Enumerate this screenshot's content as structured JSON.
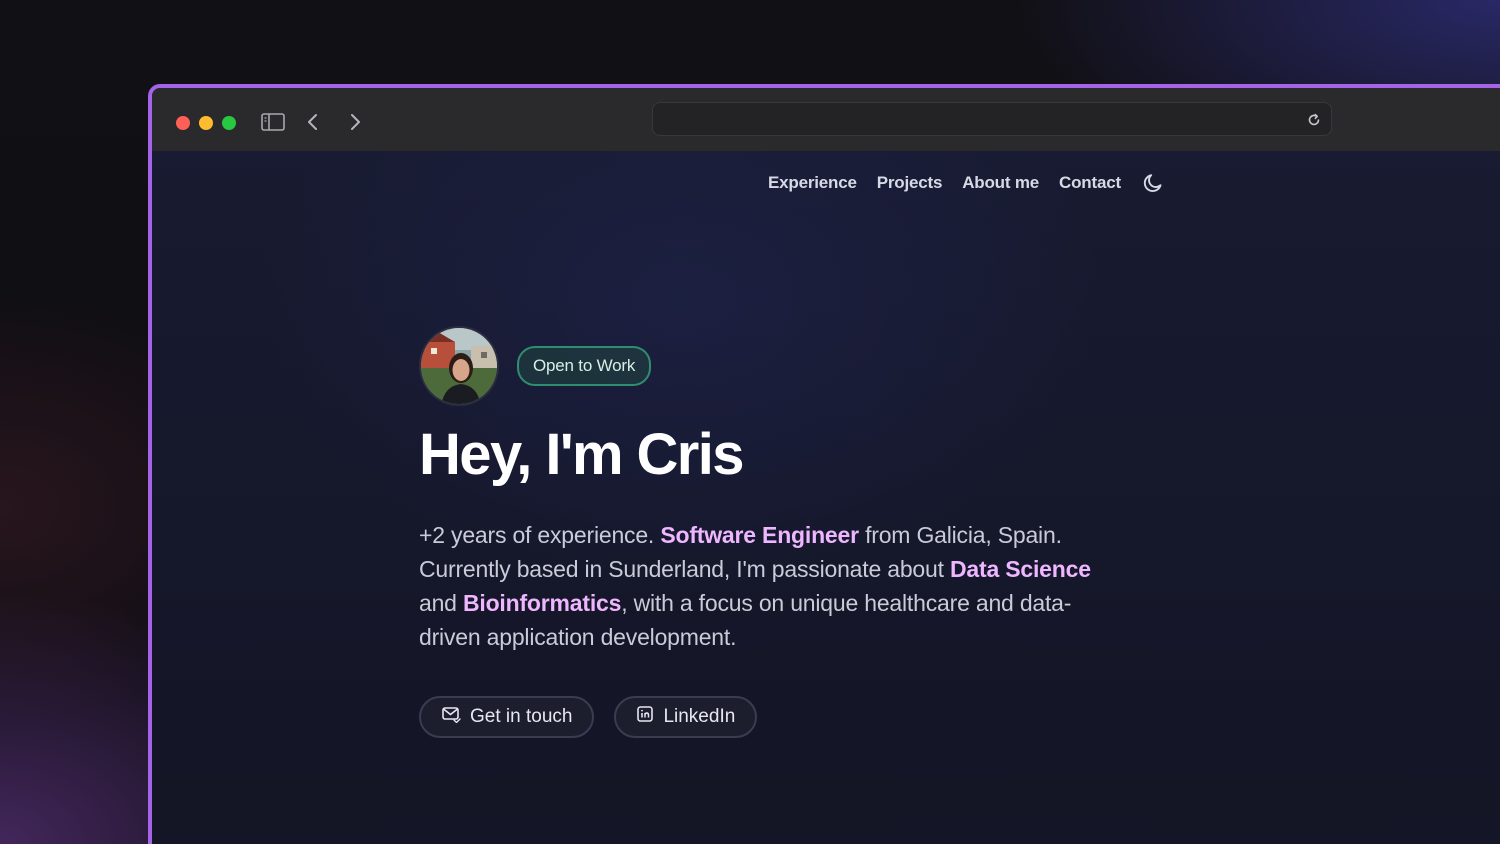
{
  "browser": {
    "url": "",
    "icons": {
      "sidebar": "sidebar-icon",
      "back": "chevron-left-icon",
      "forward": "chevron-right-icon",
      "reload": "reload-icon"
    }
  },
  "nav": {
    "items": [
      {
        "label": "Experience"
      },
      {
        "label": "Projects"
      },
      {
        "label": "About me"
      },
      {
        "label": "Contact"
      }
    ],
    "theme_icon": "moon-icon"
  },
  "hero": {
    "badge": "Open to Work",
    "title": "Hey, I'm Cris",
    "bio": {
      "p1": "+2 years of experience. ",
      "h1": "Software Engineer",
      "p2": " from Galicia, Spain. Currently based in Sunderland, I'm passionate about ",
      "h2": "Data Science",
      "p3": " and ",
      "h3": "Bioinformatics",
      "p4": ", with a focus on unique healthcare and data-driven application development."
    },
    "buttons": {
      "contact": "Get in touch",
      "linkedin": "LinkedIn"
    }
  },
  "colors": {
    "accent_border": "#a464e8",
    "highlight": "#eeb6ff",
    "badge_border": "#2f8d72"
  }
}
